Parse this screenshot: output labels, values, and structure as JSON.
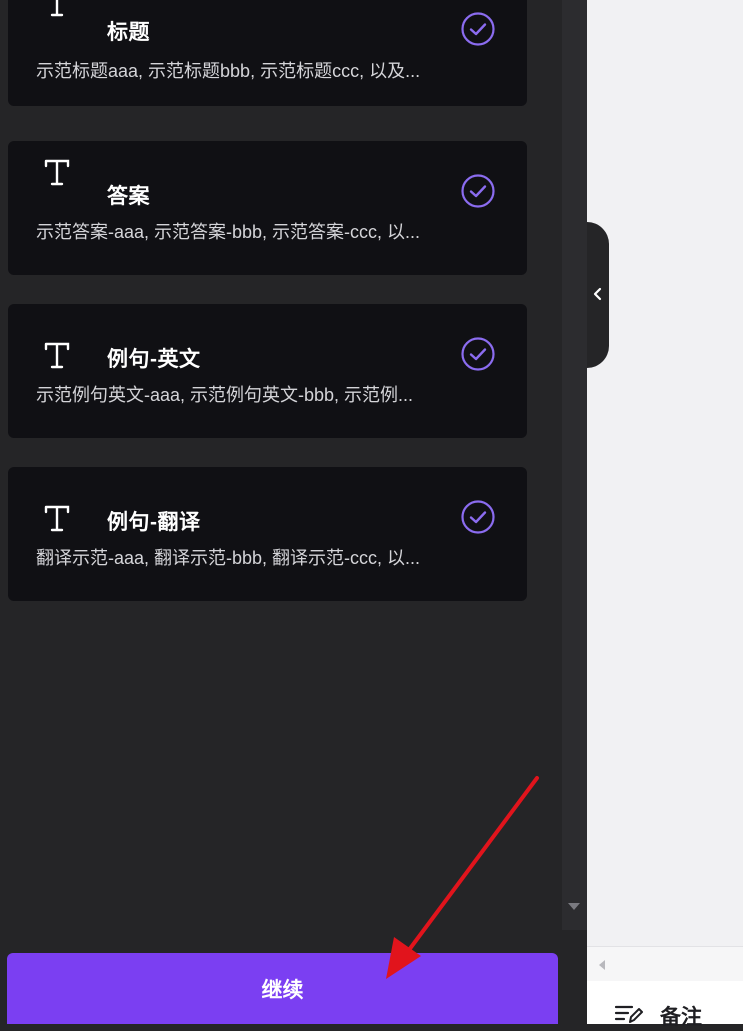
{
  "panel": {
    "cards": [
      {
        "title": "标题",
        "description": "示范标题aaa, 示范标题bbb, 示范标题ccc, 以及..."
      },
      {
        "title": "答案",
        "description": "示范答案-aaa, 示范答案-bbb, 示范答案-ccc, 以..."
      },
      {
        "title": "例句-英文",
        "description": "示范例句英文-aaa, 示范例句英文-bbb, 示范例..."
      },
      {
        "title": "例句-翻译",
        "description": "翻译示范-aaa, 翻译示范-bbb, 翻译示范-ccc, 以..."
      }
    ],
    "continue_label": "继续"
  },
  "right": {
    "notes_label": "备注"
  },
  "colors": {
    "accent": "#7b3ff2",
    "check": "#8b6cf0",
    "card_bg": "#101014",
    "panel_bg": "#252527",
    "annotation_arrow": "#e1141c"
  },
  "icons": {
    "card_type": "text-type-icon",
    "card_status": "check-circle-icon",
    "collapse": "chevron-left-icon",
    "notes": "notes-edit-icon"
  }
}
